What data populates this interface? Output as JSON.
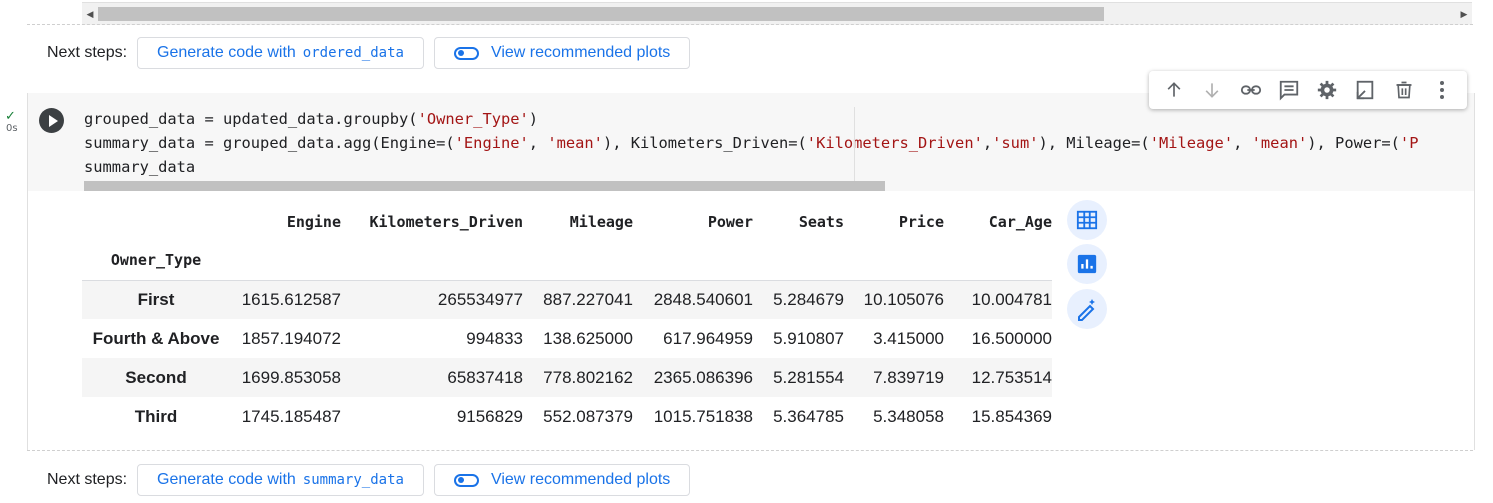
{
  "prev_next_steps": {
    "label": "Next steps:",
    "generate_prefix": "Generate code with",
    "generate_var": "ordered_data",
    "view_plots": "View recommended plots"
  },
  "cell": {
    "exec_time": "0s",
    "code": {
      "line1_a": "grouped_data = updated_data.groupby(",
      "line1_s1": "'Owner_Type'",
      "line1_b": ")",
      "line2_a": "summary_data = grouped_data.agg(Engine=(",
      "line2_s1": "'Engine'",
      "line2_c1": ", ",
      "line2_s2": "'mean'",
      "line2_c2": "), Kilometers_Driven=(",
      "line2_s3": "'Kilometers_Driven'",
      "line2_c3": ",",
      "line2_s4": "'sum'",
      "line2_c4": "), Mileage=(",
      "line2_s5": "'Mileage'",
      "line2_c5": ", ",
      "line2_s6": "'mean'",
      "line2_c6": "), Power=(",
      "line2_s7": "'P",
      "line3": "summary_data"
    }
  },
  "toolbar": {
    "icons": [
      "arrow-up-icon",
      "arrow-down-icon",
      "link-icon",
      "comment-icon",
      "gear-icon",
      "open-in-tab-icon",
      "trash-icon",
      "more-vert-icon"
    ]
  },
  "table": {
    "columns": [
      "Engine",
      "Kilometers_Driven",
      "Mileage",
      "Power",
      "Seats",
      "Price",
      "Car_Age"
    ],
    "index_name": "Owner_Type",
    "rows": [
      {
        "index": "First",
        "values": [
          "1615.612587",
          "265534977",
          "887.227041",
          "2848.540601",
          "5.284679",
          "10.105076",
          "10.004781"
        ]
      },
      {
        "index": "Fourth & Above",
        "values": [
          "1857.194072",
          "994833",
          "138.625000",
          "617.964959",
          "5.910807",
          "3.415000",
          "16.500000"
        ]
      },
      {
        "index": "Second",
        "values": [
          "1699.853058",
          "65837418",
          "778.802162",
          "2365.086396",
          "5.281554",
          "7.839719",
          "12.753514"
        ]
      },
      {
        "index": "Third",
        "values": [
          "1745.185487",
          "9156829",
          "552.087379",
          "1015.751838",
          "5.364785",
          "5.348058",
          "15.854369"
        ]
      }
    ]
  },
  "side_buttons": [
    "table-icon",
    "chart-icon",
    "magic-pen-icon"
  ],
  "next_steps": {
    "label": "Next steps:",
    "generate_prefix": "Generate code with",
    "generate_var": "summary_data",
    "view_plots": "View recommended plots"
  },
  "colors": {
    "accent": "#1a73e8",
    "string": "#a31515",
    "check": "#188038"
  }
}
